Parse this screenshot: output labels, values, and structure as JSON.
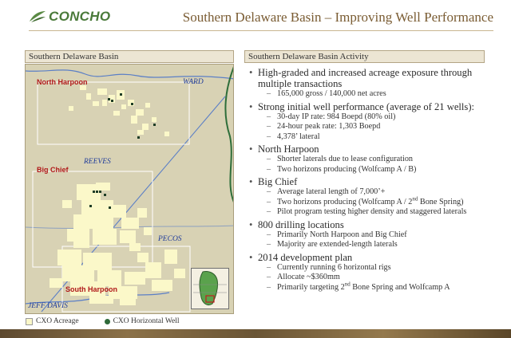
{
  "header": {
    "logo_text": "CONCHO",
    "title": "Southern Delaware Basin – Improving Well Performance"
  },
  "map_panel": {
    "heading": "Southern Delaware Basin",
    "labels": {
      "north_harpoon": "North Harpoon",
      "ward": "WARD",
      "big_chief": "Big Chief",
      "reeves": "REEVES",
      "pecos": "PECOS",
      "south_harpoon": "South Harpoon",
      "jeff_davis": "JEFF DAVIS"
    },
    "colors": {
      "map_bg": "#d8d2b4",
      "acreage": "#fbf8c9",
      "wells": "#1f3d26",
      "county_lines": "#5b7fc6",
      "region_red": "#b01818",
      "river": "#2e6e3a"
    },
    "legend": {
      "acreage": "CXO Acreage",
      "wells": "CXO Horizontal Well"
    }
  },
  "activity_panel": {
    "heading": "Southern Delaware Basin Activity",
    "bullets": [
      {
        "text": "High-graded and increased acreage exposure through multiple transactions",
        "subs": [
          {
            "text": "165,000 gross / 140,000 net acres"
          }
        ]
      },
      {
        "text": "Strong initial well performance (average of 21 wells):",
        "subs": [
          {
            "text": "30-day IP rate: 984 Boepd (80% oil)"
          },
          {
            "text": "24-hour peak rate: 1,303 Boepd"
          },
          {
            "text": "4,378’ lateral"
          }
        ]
      },
      {
        "text": "North Harpoon",
        "subs": [
          {
            "text": "Shorter laterals due to lease configuration"
          },
          {
            "text": "Two horizons producing (Wolfcamp A / B)"
          }
        ]
      },
      {
        "text": "Big Chief",
        "subs": [
          {
            "text": "Average lateral length of 7,000’+"
          },
          {
            "pre": "Two horizons producing (Wolfcamp A / 2",
            "sup": "nd",
            "post": " Bone Spring)"
          },
          {
            "text": "Pilot program testing higher density and staggered laterals"
          }
        ]
      },
      {
        "text": "800 drilling locations",
        "subs": [
          {
            "text": "Primarily North Harpoon and Big Chief"
          },
          {
            "text": "Majority are extended-length laterals"
          }
        ]
      },
      {
        "text": "2014 development plan",
        "subs": [
          {
            "text": "Currently running 6 horizontal rigs"
          },
          {
            "text": "Allocate ~$360mm"
          },
          {
            "pre": "Primarily targeting 2",
            "sup": "nd",
            "post": " Bone Spring and Wolfcamp A"
          }
        ]
      }
    ]
  }
}
